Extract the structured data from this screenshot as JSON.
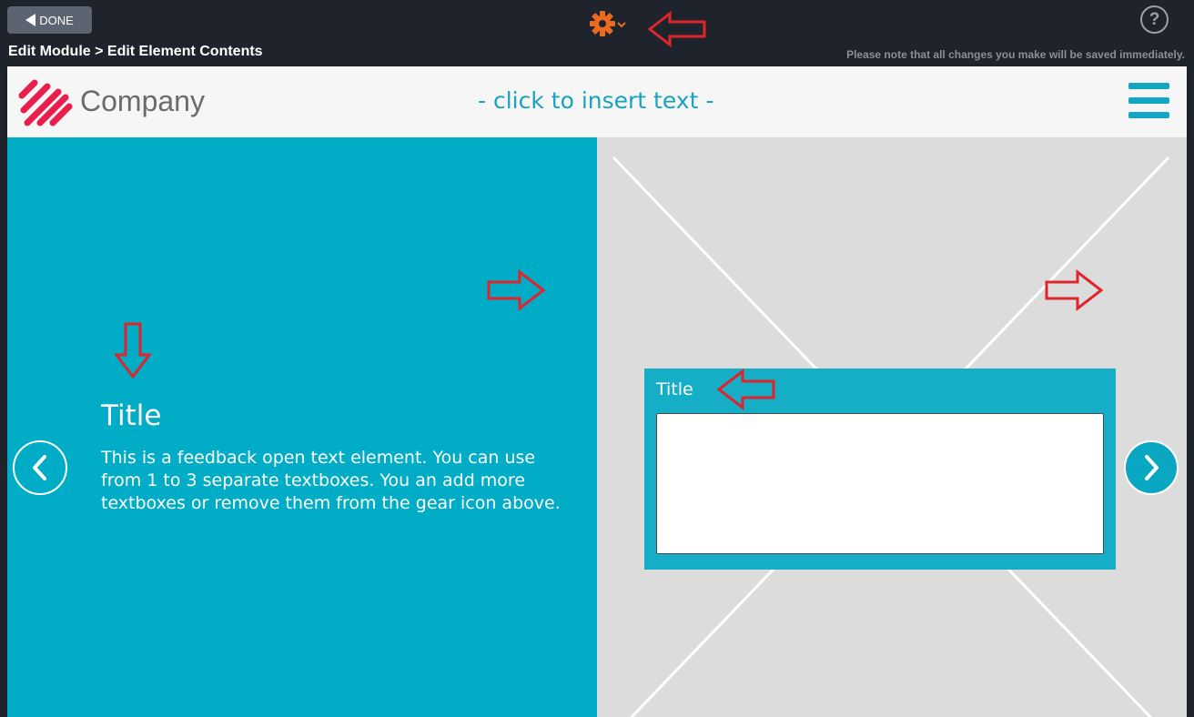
{
  "topbar": {
    "done_label": "DONE",
    "breadcrumb": "Edit Module > Edit Element Contents",
    "save_note": "Please note that all changes you make will be saved immediately.",
    "help_label": "?",
    "gear_color": "#ec6a1e"
  },
  "header": {
    "logo_text": "Company",
    "insert_text": "- click to insert text -",
    "brand_color": "#e81e4d",
    "accent_color": "#13a5c2"
  },
  "content": {
    "left_title": "Title",
    "left_body": "This is a feedback open text element. You can use from 1 to 3 separate textboxes. You an add more textboxes or remove them from the gear icon above.",
    "card_title": "Title",
    "card_value": ""
  },
  "colors": {
    "panel_left": "#00acc6",
    "panel_right": "#dcdcdc",
    "annotation_arrow": "#e0242b"
  }
}
